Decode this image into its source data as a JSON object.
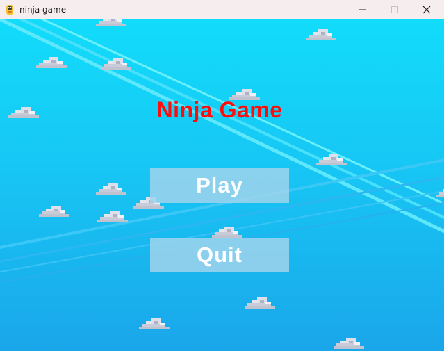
{
  "window": {
    "title": "ninja game",
    "icon": "python-icon",
    "controls": [
      "minimize-icon",
      "maximize-icon",
      "close-icon"
    ]
  },
  "game": {
    "title": "Ninja Game",
    "title_color": "#ff0d0d",
    "buttons": {
      "play_label": "Play",
      "quit_label": "Quit"
    },
    "colors": {
      "sky_top": "#12d8f8",
      "sky_bottom": "#1aa8ec",
      "button_fill": "#a0d4ec",
      "button_text": "#ffffff"
    }
  }
}
